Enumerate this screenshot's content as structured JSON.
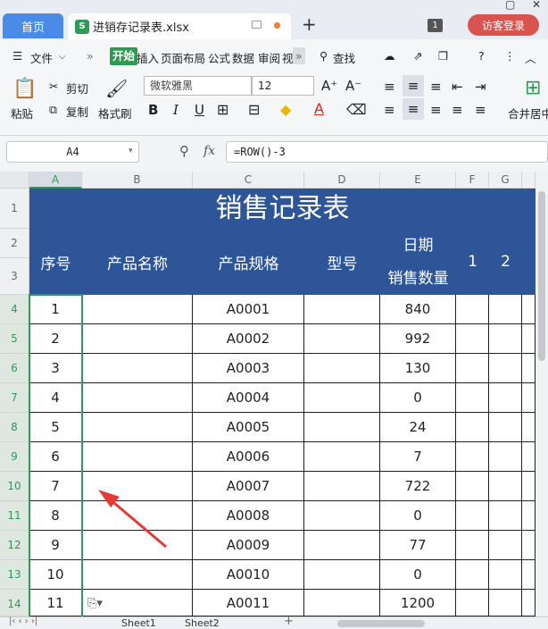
{
  "tabs": {
    "home": "首页",
    "file": "进销存记录表.xlsx",
    "new_tab": "+",
    "counter": "1",
    "visitor": "访客登录"
  },
  "menu": {
    "file": "文件",
    "more": "»",
    "items": [
      "开始",
      "插入",
      "页面布局",
      "公式",
      "数据",
      "审阅",
      "视"
    ],
    "overflow": "»",
    "search": "查找",
    "help": "?"
  },
  "ribbon": {
    "paste": "粘贴",
    "cut": "剪切",
    "copy": "复制",
    "format_painter": "格式刷",
    "font_name": "微软雅黑",
    "font_size": "12",
    "bold": "B",
    "italic": "I",
    "underline": "U",
    "font_color": "A",
    "merge_center": "合并居中"
  },
  "formula": {
    "name_box": "A4",
    "fx": "fx",
    "formula": "=ROW()-3"
  },
  "columns": [
    "A",
    "B",
    "C",
    "D",
    "E",
    "F",
    "G"
  ],
  "rows": [
    "1",
    "2",
    "3",
    "4",
    "5",
    "6",
    "7",
    "8",
    "9",
    "10",
    "11",
    "12",
    "13",
    "14"
  ],
  "sheet": {
    "title": "销售记录表",
    "headers": {
      "seq": "序号",
      "product_name": "产品名称",
      "spec": "产品规格",
      "model": "型号",
      "date": "日期",
      "qty": "销售数量",
      "f": "1",
      "g": "2"
    },
    "data": [
      {
        "seq": "1",
        "spec": "A0001",
        "qty": "840"
      },
      {
        "seq": "2",
        "spec": "A0002",
        "qty": "992"
      },
      {
        "seq": "3",
        "spec": "A0003",
        "qty": "130"
      },
      {
        "seq": "4",
        "spec": "A0004",
        "qty": "0"
      },
      {
        "seq": "5",
        "spec": "A0005",
        "qty": "24"
      },
      {
        "seq": "6",
        "spec": "A0006",
        "qty": "7"
      },
      {
        "seq": "7",
        "spec": "A0007",
        "qty": "722"
      },
      {
        "seq": "8",
        "spec": "A0008",
        "qty": "0"
      },
      {
        "seq": "9",
        "spec": "A0009",
        "qty": "77"
      },
      {
        "seq": "10",
        "spec": "A0010",
        "qty": "0"
      },
      {
        "seq": "11",
        "spec": "A0011",
        "qty": "1200"
      }
    ]
  },
  "sheets": [
    "Sheet1",
    "Sheet2"
  ],
  "colors": {
    "accent": "#2e9a58",
    "banner": "#2e5597",
    "arrow": "#e53935"
  }
}
